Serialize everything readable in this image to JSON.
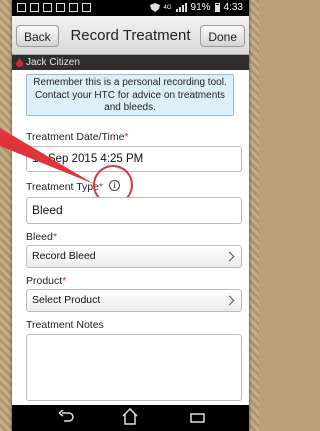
{
  "nav": {
    "back_label": "Back",
    "title": "Record Treatment",
    "done_label": "Done"
  },
  "status": {
    "battery_percent": "91%",
    "time": "4:33",
    "network": "4G"
  },
  "patient": {
    "name": "Jack Citizen"
  },
  "notice": {
    "text": "Remember this is a personal recording tool. Contact your HTC for advice on treatments and bleeds."
  },
  "form": {
    "date_label": "Treatment Date/Time",
    "date_value": "15 Sep 2015 4:25 PM",
    "type_label": "Treatment Type",
    "type_value": "Bleed",
    "info_glyph": "i",
    "bleed_label": "Bleed",
    "bleed_value": "Record Bleed",
    "product_label": "Product",
    "product_value": "Select Product",
    "notes_label": "Treatment Notes",
    "required_mark": "*"
  },
  "colors": {
    "required": "#d9253a",
    "highlight": "#e0343a",
    "notice_bg": "#ddf0f8"
  },
  "icons": [
    "back-arrow-icon",
    "home-icon",
    "recent-apps-icon",
    "info-icon",
    "blood-drop-icon"
  ]
}
